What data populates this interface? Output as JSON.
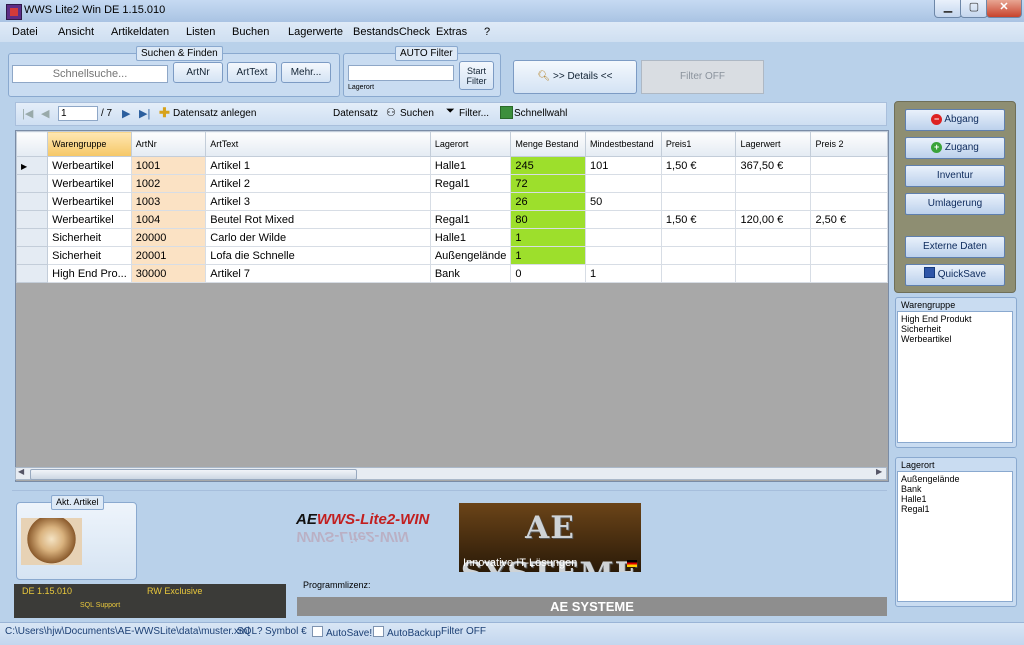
{
  "window": {
    "title": "WWS Lite2 Win DE 1.15.010"
  },
  "menu": [
    "Datei",
    "Ansicht",
    "Artikeldaten",
    "Listen",
    "Buchen",
    "Lagerwerte",
    "BestandsCheck",
    "Extras",
    "?"
  ],
  "search": {
    "group_title": "Suchen & Finden",
    "placeholder": "Schnellsuche...",
    "btn_artnr": "ArtNr",
    "btn_arttext": "ArtText",
    "btn_more": "Mehr..."
  },
  "autofilter": {
    "group_title": "AUTO Filter",
    "field_label": "Lagerort",
    "start_line1": "Start",
    "start_line2": "Filter"
  },
  "details_button": ">> Details <<",
  "filter_off_button": "Filter OFF",
  "navigator": {
    "page": "1",
    "total": "/ 7",
    "add": "Datensatz anlegen",
    "record": "Datensatz",
    "search": "Suchen",
    "filter": "Filter...",
    "quick": "Schnellwahl"
  },
  "grid": {
    "columns": [
      "Warengruppe",
      "ArtNr",
      "ArtText",
      "Lagerort",
      "Menge Bestand",
      "Mindestbestand",
      "Preis1",
      "Lagerwert",
      "Preis 2"
    ],
    "rows": [
      [
        "Werbeartikel",
        "1001",
        "Artikel 1",
        "Halle1",
        "245",
        "101",
        "1,50 €",
        "367,50 €",
        ""
      ],
      [
        "Werbeartikel",
        "1002",
        "Artikel 2",
        "Regal1",
        "72",
        "",
        "",
        "",
        ""
      ],
      [
        "Werbeartikel",
        "1003",
        "Artikel 3",
        "",
        "26",
        "50",
        "",
        "",
        ""
      ],
      [
        "Werbeartikel",
        "1004",
        "Beutel Rot Mixed",
        "Regal1",
        "80",
        "",
        "1,50 €",
        "120,00 €",
        "2,50 €"
      ],
      [
        "Sicherheit",
        "20000",
        "Carlo der Wilde",
        "Halle1",
        "1",
        "",
        "",
        "",
        ""
      ],
      [
        "Sicherheit",
        "20001",
        "Lofa die Schnelle",
        "Außengelände",
        "1",
        "",
        "",
        "",
        ""
      ],
      [
        "High End Pro...",
        "30000",
        "Artikel 7",
        "Bank",
        "0",
        "1",
        "",
        "",
        ""
      ]
    ]
  },
  "actions": {
    "abgang": "Abgang",
    "zugang": "Zugang",
    "inventur": "Inventur",
    "umlagerung": "Umlagerung",
    "externe": "Externe Daten",
    "quicksave": "QuickSave"
  },
  "warengruppe": {
    "title": "Warengruppe",
    "items": [
      "High End Produkt",
      "Sicherheit",
      "Werbeartikel"
    ]
  },
  "lagerort": {
    "title": "Lagerort",
    "items": [
      "Außengelände",
      "Bank",
      "Halle1",
      "Regal1"
    ]
  },
  "akt_artikel": {
    "title": "Akt. Artikel"
  },
  "brand": {
    "logo_prefix": "AE",
    "logo_text": "WWS-Lite2-WIN",
    "systeme_big": "AE SYSTEME",
    "systeme_sub": "Innovative IT-Lösungen",
    "license_label": "Programmlizenz:",
    "license_value": "AE SYSTEME"
  },
  "version_box": {
    "version": "DE 1.15.010",
    "mode": "RW Exclusive",
    "sql": "SQL Support"
  },
  "status": {
    "path": "C:\\Users\\hjw\\Documents\\AE-WWSLite\\data\\muster.xml",
    "sql": "SQL?",
    "symbol": "Symbol €",
    "autosave": "AutoSave!",
    "autobackup": "AutoBackup",
    "filter": "Filter OFF"
  },
  "colors": {
    "stock_green": "#9ddf2c",
    "artnr_bg": "#fbe2c4",
    "accent": "#b9d1ea"
  }
}
